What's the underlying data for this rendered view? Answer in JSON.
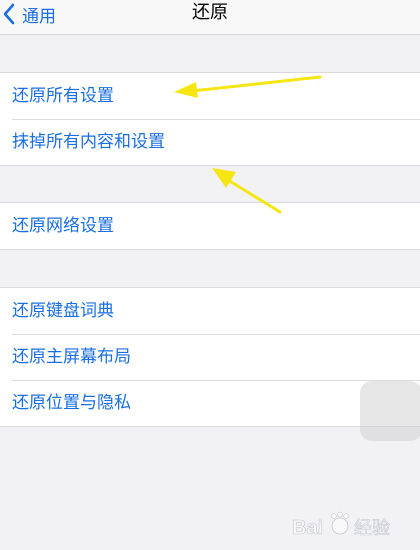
{
  "nav": {
    "back_label": "通用",
    "title": "还原"
  },
  "groups": {
    "reset": [
      {
        "label": "还原所有设置"
      },
      {
        "label": "抹掉所有内容和设置"
      }
    ],
    "network": [
      {
        "label": "还原网络设置"
      }
    ],
    "other": [
      {
        "label": "还原键盘词典"
      },
      {
        "label": "还原主屏幕布局"
      },
      {
        "label": "还原位置与隐私"
      }
    ]
  },
  "annotation_color": "#f5e612",
  "accent_color": "#1a6fe0",
  "watermark": {
    "text": "Bai 经验"
  }
}
